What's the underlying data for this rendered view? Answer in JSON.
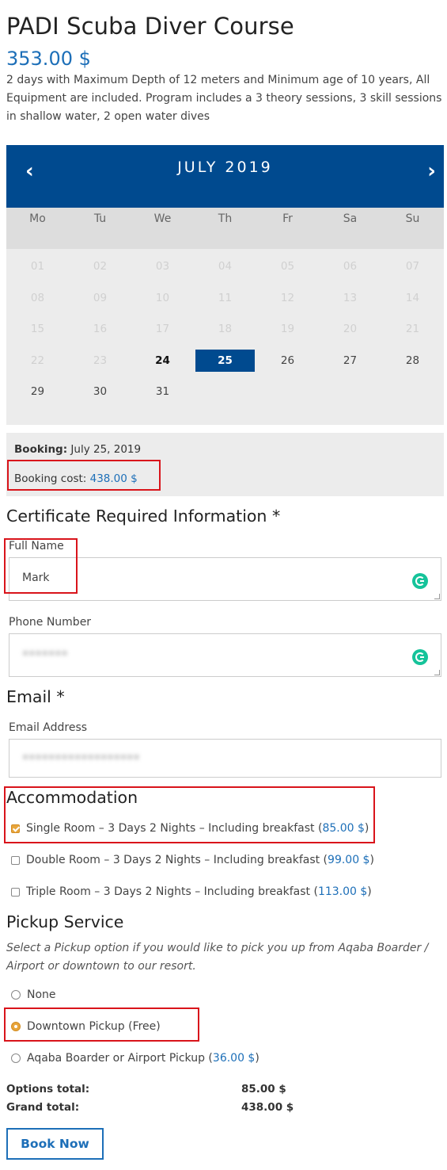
{
  "product": {
    "title": "PADI Scuba Diver Course",
    "price": "353.00 $",
    "description": "2 days with Maximum Depth of 12 meters and Minimum age of 10 years, All Equipment are included. Program includes a 3 theory sessions, 3 skill sessions in shallow water, 2 open water dives"
  },
  "calendar": {
    "prev": "‹",
    "next": "›",
    "month": "JULY 2019",
    "dows": [
      "Mo",
      "Tu",
      "We",
      "Th",
      "Fr",
      "Sa",
      "Su"
    ],
    "days": [
      {
        "label": "01",
        "state": "disabled"
      },
      {
        "label": "02",
        "state": "disabled"
      },
      {
        "label": "03",
        "state": "disabled"
      },
      {
        "label": "04",
        "state": "disabled"
      },
      {
        "label": "05",
        "state": "disabled"
      },
      {
        "label": "06",
        "state": "disabled"
      },
      {
        "label": "07",
        "state": "disabled"
      },
      {
        "label": "08",
        "state": "disabled"
      },
      {
        "label": "09",
        "state": "disabled"
      },
      {
        "label": "10",
        "state": "disabled"
      },
      {
        "label": "11",
        "state": "disabled"
      },
      {
        "label": "12",
        "state": "disabled"
      },
      {
        "label": "13",
        "state": "disabled"
      },
      {
        "label": "14",
        "state": "disabled"
      },
      {
        "label": "15",
        "state": "disabled"
      },
      {
        "label": "16",
        "state": "disabled"
      },
      {
        "label": "17",
        "state": "disabled"
      },
      {
        "label": "18",
        "state": "disabled"
      },
      {
        "label": "19",
        "state": "disabled"
      },
      {
        "label": "20",
        "state": "disabled"
      },
      {
        "label": "21",
        "state": "disabled"
      },
      {
        "label": "22",
        "state": "disabled"
      },
      {
        "label": "23",
        "state": "disabled"
      },
      {
        "label": "24",
        "state": "today"
      },
      {
        "label": "25",
        "state": "selected"
      },
      {
        "label": "26",
        "state": "available"
      },
      {
        "label": "27",
        "state": "available"
      },
      {
        "label": "28",
        "state": "available"
      },
      {
        "label": "29",
        "state": "available"
      },
      {
        "label": "30",
        "state": "available"
      },
      {
        "label": "31",
        "state": "available"
      }
    ]
  },
  "booking": {
    "date_label": "Booking:",
    "date_value": "July 25, 2019",
    "cost_label": "Booking cost:",
    "cost_value": "438.00 $"
  },
  "certificate": {
    "heading": "Certificate Required Information *",
    "full_name_label": "Full Name",
    "full_name_value": "Mark",
    "phone_label": "Phone Number"
  },
  "email": {
    "heading": "Email *",
    "label": "Email Address"
  },
  "accommodation": {
    "heading": "Accommodation",
    "options": [
      {
        "label": "Single Room – 3 Days 2 Nights – Including breakfast",
        "price": "85.00 $",
        "checked": true
      },
      {
        "label": "Double Room – 3 Days 2 Nights – Including breakfast",
        "price": "99.00 $",
        "checked": false
      },
      {
        "label": "Triple Room – 3 Days 2 Nights – Including breakfast",
        "price": "113.00 $",
        "checked": false
      }
    ]
  },
  "pickup": {
    "heading": "Pickup Service",
    "note": "Select a Pickup option if you would like to pick you up from Aqaba Boarder / Airport or downtown to our resort.",
    "options": [
      {
        "label": "None",
        "price": "",
        "checked": false
      },
      {
        "label": "Downtown Pickup (Free)",
        "price": "",
        "checked": true
      },
      {
        "label": "Aqaba Boarder or Airport Pickup",
        "price": "36.00 $",
        "checked": false
      }
    ]
  },
  "totals": {
    "options_label": "Options total:",
    "options_value": "85.00 $",
    "grand_label": "Grand total:",
    "grand_value": "438.00 $"
  },
  "book_button": "Book Now",
  "colors": {
    "accent": "#1d6fb8",
    "calendar_header": "#004a8f",
    "highlight_box": "#d9141b",
    "checked": "#e8a53b"
  }
}
